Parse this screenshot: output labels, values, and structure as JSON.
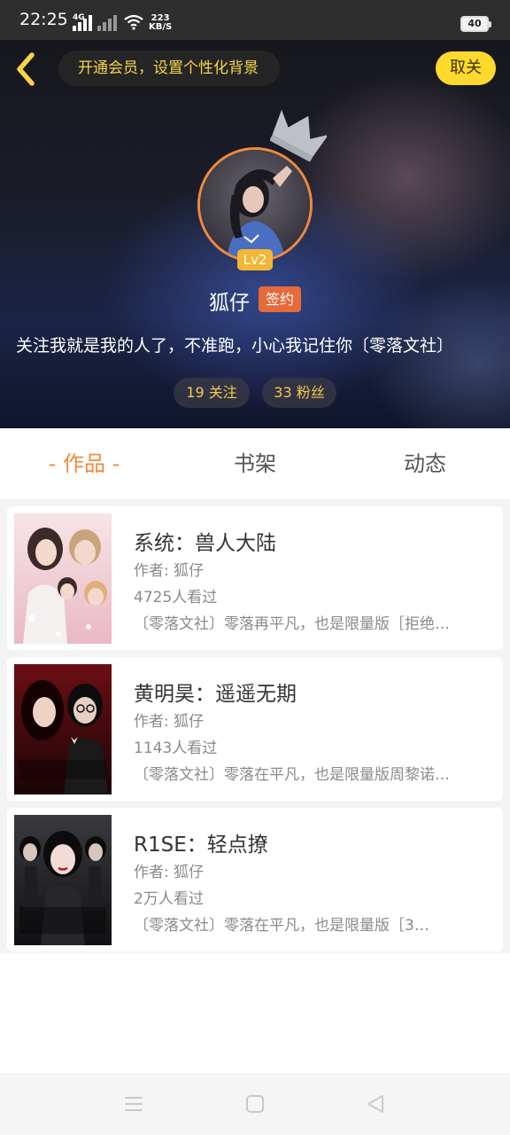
{
  "status_bar": {
    "time": "22:25",
    "network_label": "4G",
    "network_speed_value": "223",
    "network_speed_unit": "KB/S",
    "battery_level": "40"
  },
  "header": {
    "vip_banner_text": "开通会员，设置个性化背景",
    "cancel_label": "取关",
    "level_badge": "Lv2",
    "username": "狐仔",
    "signed_badge": "签约",
    "bio": "关注我就是我的人了，不准跑，小心我记住你〔零落文社〕",
    "following_label": "19 关注",
    "followers_label": "33 粉丝"
  },
  "tabs": [
    {
      "label": "- 作品 -",
      "active": true
    },
    {
      "label": "书架",
      "active": false
    },
    {
      "label": "动态",
      "active": false
    }
  ],
  "books": [
    {
      "title": "系统：兽人大陆",
      "author": "作者: 狐仔",
      "views": "4725人看过",
      "description": "〔零落文社〕零落再平凡，也是限量版［拒绝…"
    },
    {
      "title": "黄明昊：遥遥无期",
      "author": "作者: 狐仔",
      "views": "1143人看过",
      "description": "〔零落文社〕零落在平凡，也是限量版周黎诺…"
    },
    {
      "title": "R1SE：轻点撩",
      "author": "作者: 狐仔",
      "views": "2万人看过",
      "description": "〔零落文社〕零落在平凡，也是限量版［3…"
    }
  ],
  "colors": {
    "accent_orange": "#f08a3c",
    "vip_yellow": "#ffd92e",
    "stat_text": "#f5c84a",
    "signed_badge": "#e66a3a"
  },
  "icons": [
    "back-arrow-icon",
    "crown-icon",
    "menu-icon",
    "home-square-icon",
    "back-triangle-icon"
  ]
}
